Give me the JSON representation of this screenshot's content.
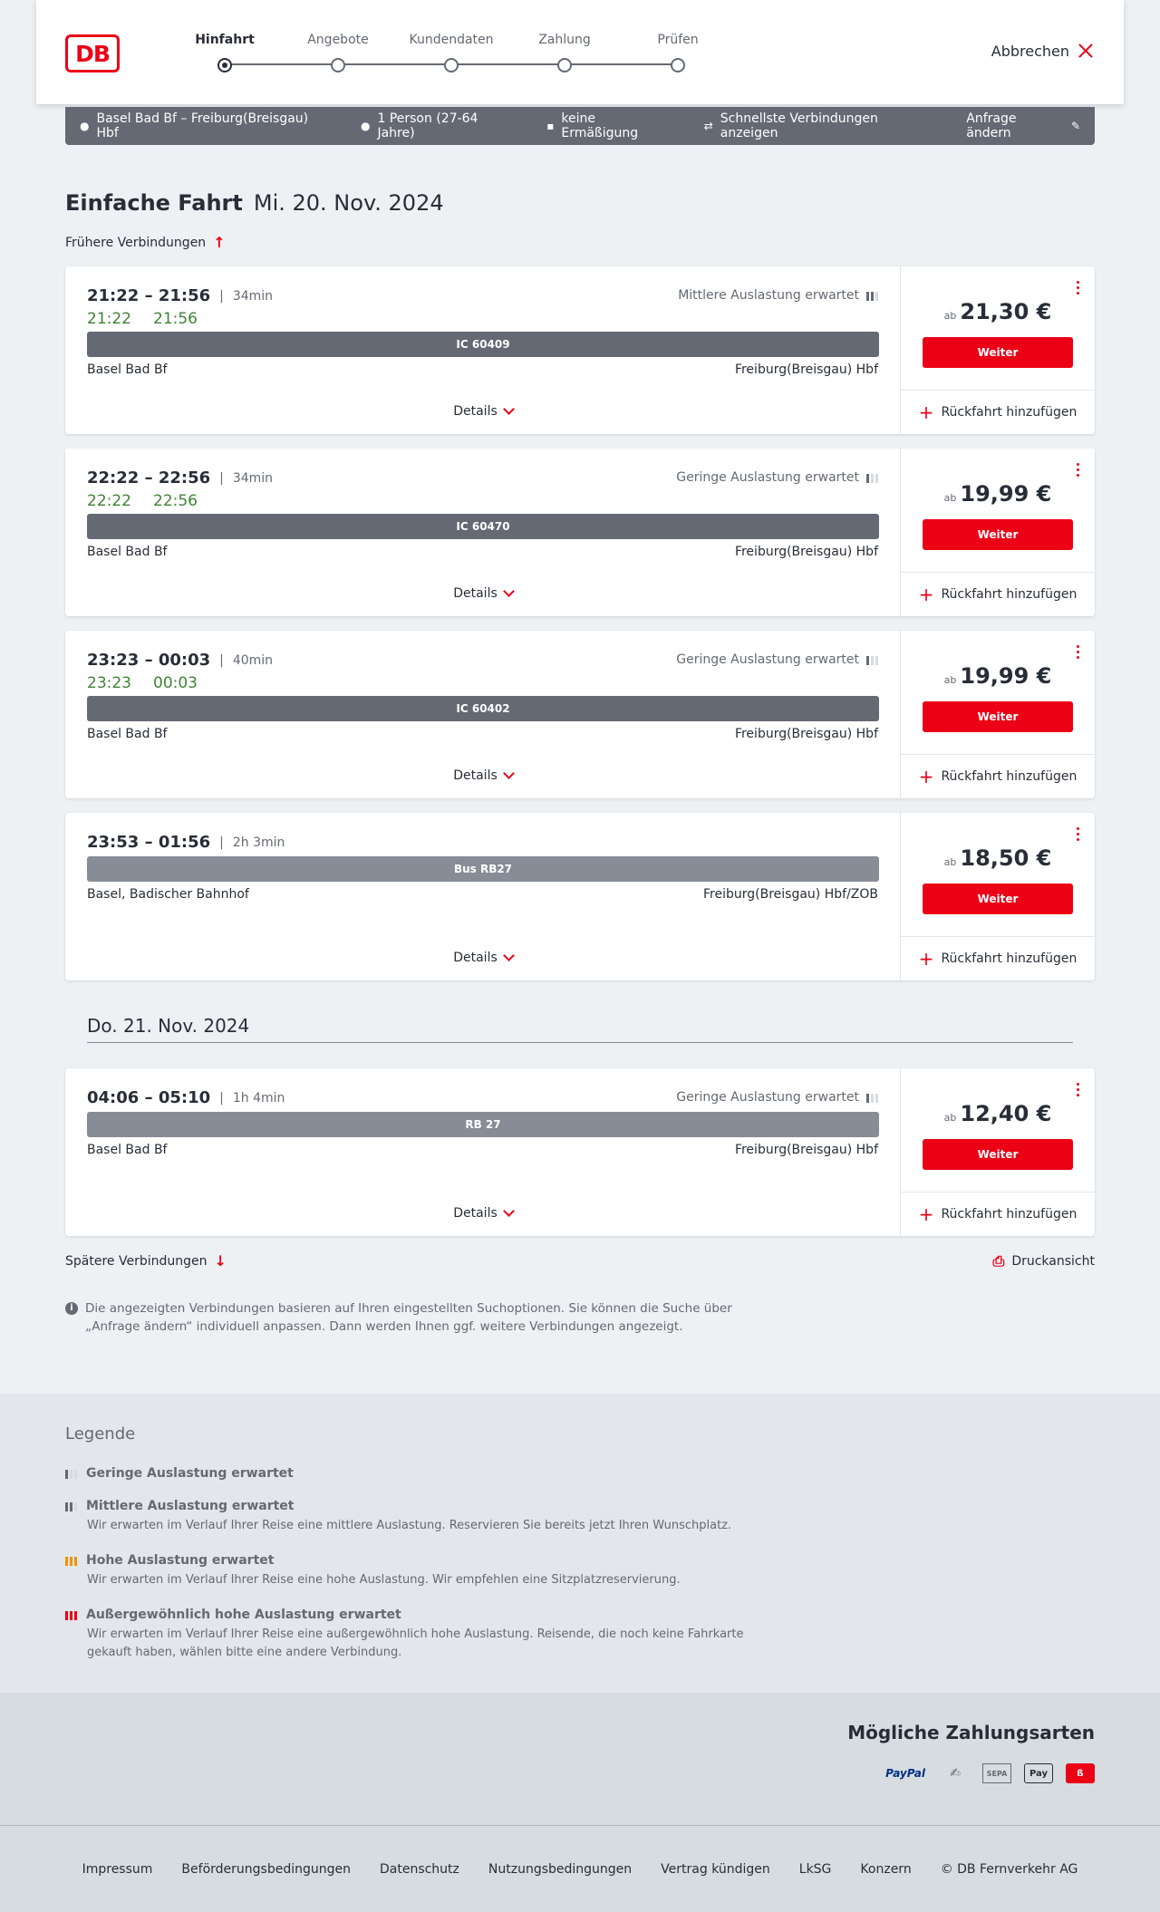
{
  "header": {
    "logo": "DB",
    "steps": [
      "Hinfahrt",
      "Angebote",
      "Kundendaten",
      "Zahlung",
      "Prüfen"
    ],
    "active_step": 0,
    "cancel": "Abbrechen"
  },
  "search": {
    "route": "Basel Bad Bf – Freiburg(Breisgau) Hbf",
    "travelers": "1 Person (27-64 Jahre)",
    "discount": "keine Ermäßigung",
    "option": "Schnellste Verbindungen anzeigen",
    "change": "Anfrage ändern"
  },
  "page": {
    "title": "Einfache Fahrt",
    "date": "Mi. 20. Nov. 2024",
    "earlier": "Frühere Verbindungen",
    "later": "Spätere Verbindungen",
    "print": "Druckansicht",
    "next_date": "Do. 21. Nov. 2024",
    "note": "Die angezeigten Verbindungen basieren auf Ihren eingestellten Suchoptionen. Sie können die Suche über „Anfrage ändern“ individuell anpassen. Dann werden Ihnen ggf. weitere Verbindungen angezeigt."
  },
  "labels": {
    "details": "Details",
    "continue": "Weiter",
    "return": "Rückfahrt hinzufügen",
    "from_prefix": "ab"
  },
  "connections": [
    {
      "time": "21:22 – 21:56",
      "duration": "34min",
      "rt_dep": "21:22",
      "rt_arr": "21:56",
      "occupancy": "Mittlere Auslastung erwartet",
      "train": "IC 60409",
      "from": "Basel Bad Bf",
      "to": "Freiburg(Breisgau) Hbf",
      "price": "21,30 €"
    },
    {
      "time": "22:22 – 22:56",
      "duration": "34min",
      "rt_dep": "22:22",
      "rt_arr": "22:56",
      "occupancy": "Geringe Auslastung erwartet",
      "train": "IC 60470",
      "from": "Basel Bad Bf",
      "to": "Freiburg(Breisgau) Hbf",
      "price": "19,99 €"
    },
    {
      "time": "23:23 – 00:03",
      "duration": "40min",
      "rt_dep": "23:23",
      "rt_arr": "00:03",
      "occupancy": "Geringe Auslastung erwartet",
      "train": "IC 60402",
      "from": "Basel Bad Bf",
      "to": "Freiburg(Breisgau) Hbf",
      "price": "19,99 €"
    },
    {
      "time": "23:53 – 01:56",
      "duration": "2h 3min",
      "train": "Bus RB27",
      "from": "Basel, Badischer Bahnhof",
      "to": "Freiburg(Breisgau) Hbf/ZOB",
      "price": "18,50 €"
    },
    {
      "time": "04:06 – 05:10",
      "duration": "1h 4min",
      "occupancy": "Geringe Auslastung erwartet",
      "train": "RB 27",
      "from": "Basel Bad Bf",
      "to": "Freiburg(Breisgau) Hbf",
      "price": "12,40 €"
    }
  ],
  "legend": {
    "title": "Legende",
    "items": [
      {
        "label": "Geringe Auslastung erwartet",
        "desc": ""
      },
      {
        "label": "Mittlere Auslastung erwartet",
        "desc": "Wir erwarten im Verlauf Ihrer Reise eine mittlere Auslastung. Reservieren Sie bereits jetzt Ihren Wunschplatz."
      },
      {
        "label": "Hohe Auslastung erwartet",
        "desc": "Wir erwarten im Verlauf Ihrer Reise eine hohe Auslastung. Wir empfehlen eine Sitzplatzreservierung."
      },
      {
        "label": "Außergewöhnlich hohe Auslastung erwartet",
        "desc": "Wir erwarten im Verlauf Ihrer Reise eine außergewöhnlich hohe Auslastung. Reisende, die noch keine Fahrkarte gekauft haben, wählen bitte eine andere Verbindung."
      }
    ]
  },
  "payments": {
    "title": "Mögliche Zahlungsarten",
    "icons": [
      "paypal-icon",
      "credit-card-icon",
      "sepa-icon",
      "apple-pay-icon",
      "db-pay-icon"
    ],
    "paypal": "PayPal",
    "sepa": "SEPA",
    "apple": "Pay"
  },
  "footer": {
    "links": [
      "Impressum",
      "Beförderungsbedingungen",
      "Datenschutz",
      "Nutzungsbedingungen",
      "Vertrag kündigen",
      "LkSG",
      "Konzern",
      "© DB Fernverkehr AG"
    ]
  },
  "colors": {
    "accent": "#ec0016",
    "realtime": "#408335",
    "bar": "#646973",
    "bar_light": "#878c96"
  }
}
